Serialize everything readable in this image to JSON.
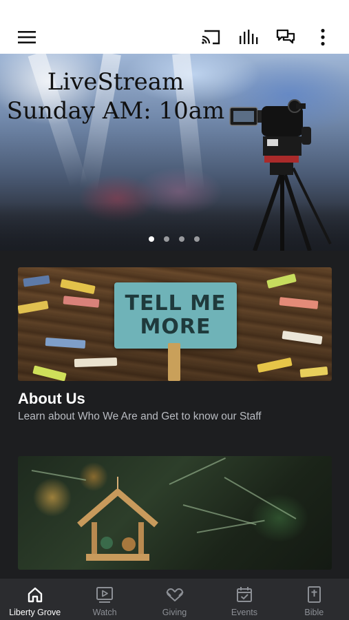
{
  "toolbar": {
    "icons": [
      "menu-icon",
      "cast-icon",
      "audio-bars-icon",
      "chat-bubbles-icon",
      "more-vertical-icon"
    ]
  },
  "hero": {
    "title_line1": "LiveStream",
    "title_line2": "Sunday AM: 10am",
    "slide_count": 4,
    "active_slide": 1
  },
  "cards": [
    {
      "image_text_line1": "TELL ME",
      "image_text_line2": "MORE",
      "title": "About Us",
      "subtitle": "Learn about Who We Are and Get to know our Staff"
    },
    {
      "title": "",
      "subtitle": ""
    }
  ],
  "tabs": [
    {
      "label": "Liberty Grove",
      "icon": "home-icon",
      "active": true
    },
    {
      "label": "Watch",
      "icon": "play-video-icon",
      "active": false
    },
    {
      "label": "Giving",
      "icon": "giving-heart-icon",
      "active": false
    },
    {
      "label": "Events",
      "icon": "calendar-check-icon",
      "active": false
    },
    {
      "label": "Bible",
      "icon": "bible-icon",
      "active": false
    }
  ],
  "colors": {
    "background": "#1d1e20",
    "toolbar": "#ffffff",
    "tabbar": "#2b2c2f",
    "tab_active": "#ffffff",
    "tab_inactive": "#8d9096"
  }
}
